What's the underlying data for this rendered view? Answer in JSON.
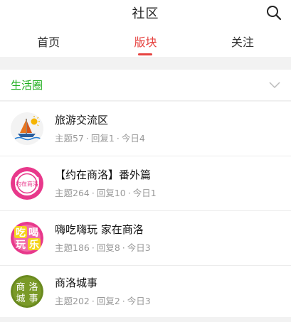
{
  "header": {
    "title": "社区",
    "search_icon": "search-icon"
  },
  "tabs": [
    {
      "label": "首页",
      "active": false
    },
    {
      "label": "版块",
      "active": true
    },
    {
      "label": "关注",
      "active": false
    }
  ],
  "section": {
    "label": "生活圈",
    "chevron_icon": "chevron-down-icon"
  },
  "colors": {
    "accent": "#e64340",
    "section": "#1aad19",
    "meta": "#999999"
  },
  "forums": [
    {
      "title": "旅游交流区",
      "topics_label": "主题57",
      "replies_label": "回复1",
      "today_label": "今日4",
      "icon": "sailboat-icon"
    },
    {
      "title": "【约在商洛】番外篇",
      "topics_label": "主题264",
      "replies_label": "回复10",
      "today_label": "今日1",
      "icon": "yuezai-shangluo-logo",
      "logo_text": "约在商洛"
    },
    {
      "title": "嗨吃嗨玩 家在商洛",
      "topics_label": "主题186",
      "replies_label": "回复8",
      "today_label": "今日3",
      "icon": "chi-he-wan-le-logo",
      "logo_text": [
        "吃",
        "喝",
        "玩",
        "乐"
      ]
    },
    {
      "title": "商洛城事",
      "topics_label": "主题202",
      "replies_label": "回复2",
      "today_label": "今日3",
      "icon": "shangluo-chengshi-logo",
      "logo_text": [
        "商",
        "洛",
        "城",
        "事"
      ]
    }
  ],
  "separator": "·"
}
